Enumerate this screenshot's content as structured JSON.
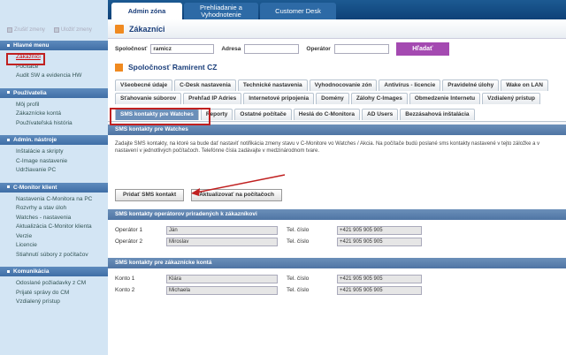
{
  "toolbar": {
    "undo_label": "Zrušiť zmeny",
    "save_label": "Uložiť zmeny"
  },
  "top_tabs": [
    "Admin zóna",
    "Prehliadanie a Vyhodnotenie",
    "Customer Desk"
  ],
  "sidebar": [
    {
      "title": "Hlavné menu",
      "items": [
        "Zákazníci",
        "Počítače",
        "Audit SW a evidencia HW"
      ]
    },
    {
      "title": "Používatelia",
      "items": [
        "Môj profil",
        "Zákaznícke kontá",
        "Používateľská história"
      ]
    },
    {
      "title": "Admin. nástroje",
      "items": [
        "Inštalácie a skripty",
        "C-Image nastavenie",
        "Udržiavanie PC"
      ]
    },
    {
      "title": "C-Monitor klient",
      "items": [
        "Nastavenia C-Monitora na PC",
        "Rozvrhy a stav úloh",
        "Watches - nastavenia",
        "Aktualizácia C-Monitor klienta",
        "Verzie",
        "Licencie",
        "Stiahnutí súbory z počítačov"
      ]
    },
    {
      "title": "Komunikácia",
      "items": [
        "Odoslané požiadavky z CM",
        "Prijaté správy do CM",
        "Vzdialený prístup"
      ]
    }
  ],
  "page": {
    "title": "Zákazníci"
  },
  "filter": {
    "company_label": "Spoločnosť",
    "company_value": "ramicz",
    "address_label": "Adresa",
    "address_value": "",
    "operator_label": "Operátor",
    "operator_value": "",
    "search_button": "Hľadať"
  },
  "company_name": "Spoločnosť Ramirent CZ",
  "tabs_row1": [
    "Všeobecné údaje",
    "C-Desk nastavenia",
    "Technické nastavenia",
    "Vyhodnocovanie zón",
    "Antivírus - licencie",
    "Pravidelné úlohy",
    "Wake on LAN"
  ],
  "tabs_row2": [
    "Sťahovanie súborov",
    "Prehľad IP Adries",
    "Internetové pripojenia",
    "Domény",
    "Zálohy C-Images",
    "Obmedzenie Internetu",
    "Vzdialený prístup"
  ],
  "tabs_row3": [
    "SMS kontakty pre Watches",
    "Reporty",
    "Ostatné počítače",
    "Heslá do C-Monitora",
    "AD Users",
    "Bezzásahová inštalácia"
  ],
  "sms": {
    "section_title": "SMS kontakty pre Watches",
    "description": "Zadajte SMS kontakty, na ktoré sa bude dať nastaviť notifikácia zmeny stavu v C-Monitore vo Watches / Akcia. Na počítače budú poslané sms kontakty nastavené v tejto záložke a v nastavení v jednotlivých počítačoch. Telefónne čísla zadávajte v medzinárodnom tvare.",
    "add_button": "Pridať SMS kontakt",
    "update_button": "Aktualizovať na počítačoch",
    "operators_title": "SMS kontakty operátorov priradených k zákazníkovi",
    "operators": [
      {
        "label": "Operátor 1",
        "name": "Ján",
        "phone_label": "Tel. číslo",
        "phone": "+421 905 905 905"
      },
      {
        "label": "Operátor 2",
        "name": "Miroslav",
        "phone_label": "Tel. číslo",
        "phone": "+421 905 905 905"
      }
    ],
    "accounts_title": "SMS kontakty pre zákaznícke kontá",
    "accounts": [
      {
        "label": "Konto 1",
        "name": "Klára",
        "phone_label": "Tel. číslo",
        "phone": "+421 905 905 905"
      },
      {
        "label": "Konto 2",
        "name": "Michaela",
        "phone_label": "Tel. číslo",
        "phone": "+421 905 905 905"
      }
    ]
  }
}
